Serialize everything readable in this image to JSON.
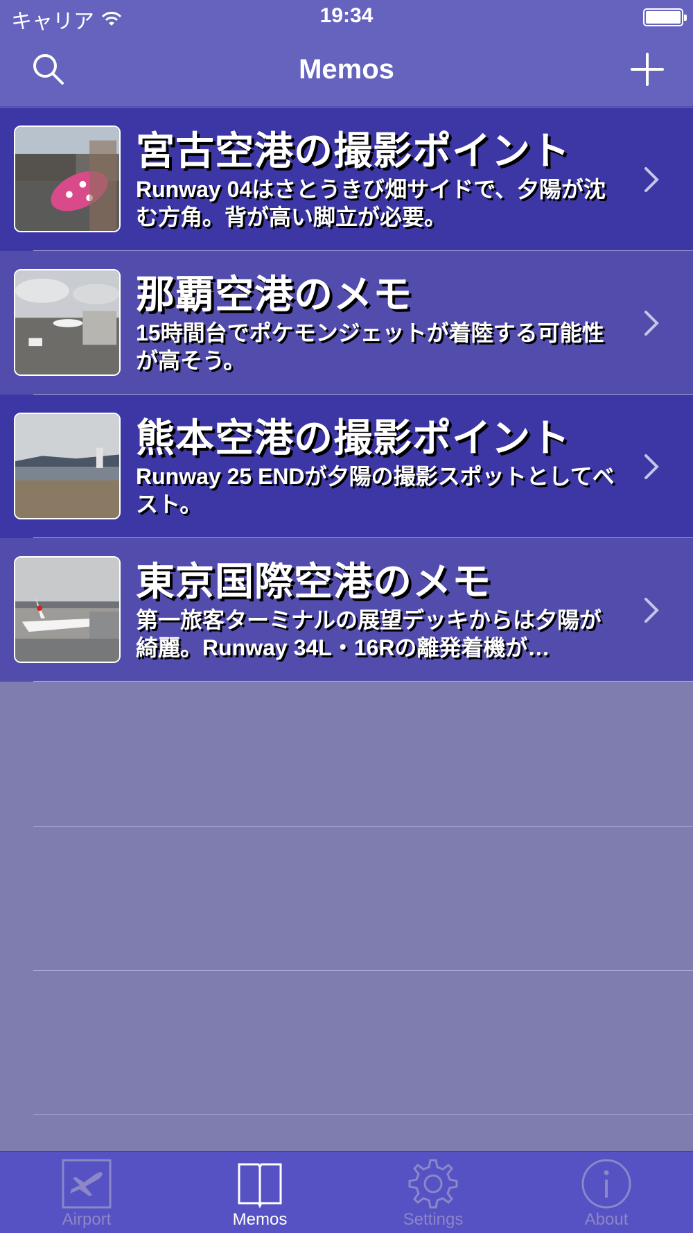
{
  "status_bar": {
    "carrier": "キャリア",
    "time": "19:34"
  },
  "nav": {
    "title": "Memos",
    "search_icon": "search-icon",
    "add_icon": "plus-icon"
  },
  "memos": [
    {
      "title": "宮古空港の撮影ポイント",
      "description": "Runway 04はさとうきび畑サイドで、夕陽が沈む方角。背が高い脚立が必要。"
    },
    {
      "title": "那覇空港のメモ",
      "description": "15時間台でポケモンジェットが着陸する可能性が高そう。"
    },
    {
      "title": "熊本空港の撮影ポイント",
      "description": "Runway 25 ENDが夕陽の撮影スポットとしてベスト。"
    },
    {
      "title": "東京国際空港のメモ",
      "description": "第一旅客ターミナルの展望デッキからは夕陽が綺麗。Runway 34L・16Rの離発着機が…"
    }
  ],
  "tabs": [
    {
      "label": "Airport",
      "icon": "airplane-icon",
      "active": false
    },
    {
      "label": "Memos",
      "icon": "book-icon",
      "active": true
    },
    {
      "label": "Settings",
      "icon": "gear-icon",
      "active": false
    },
    {
      "label": "About",
      "icon": "info-icon",
      "active": false
    }
  ],
  "colors": {
    "nav": "#6663bf",
    "row_dark": "#3d37a6",
    "row_light": "#524cad",
    "background": "#7f7db0",
    "tab_bar": "#5752c4"
  }
}
